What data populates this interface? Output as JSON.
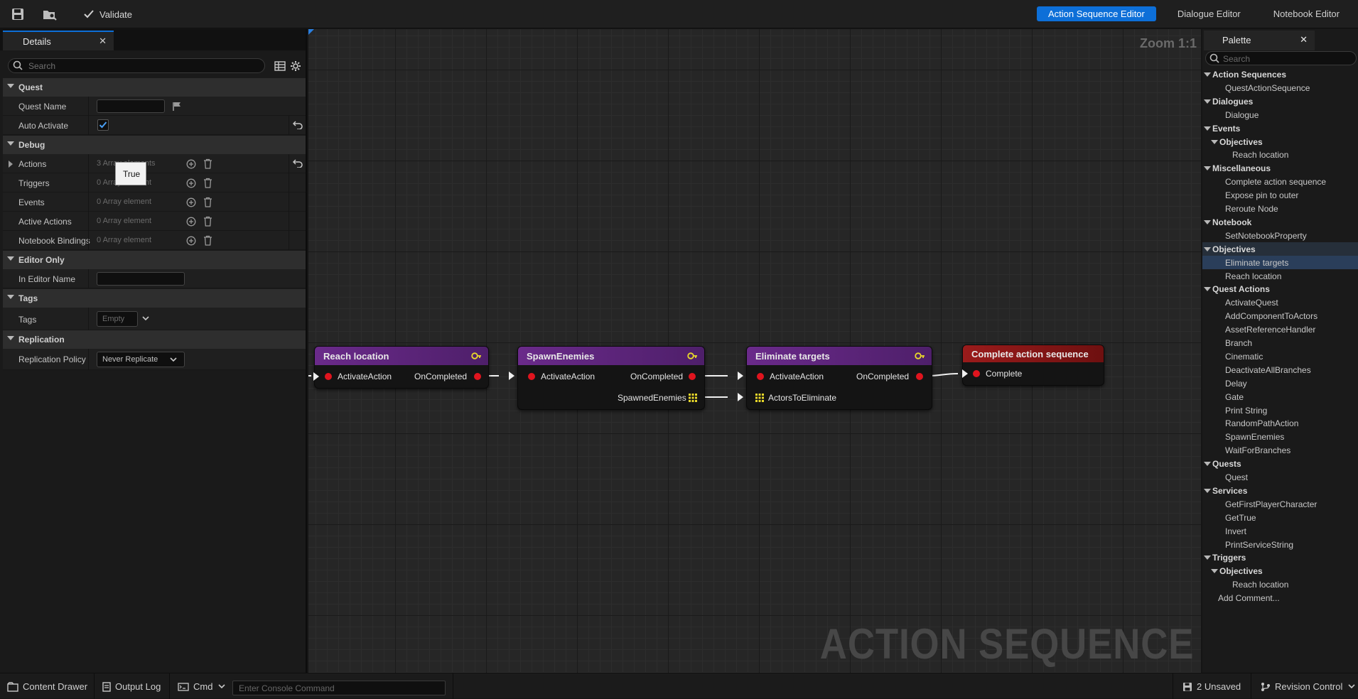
{
  "toolbar": {
    "validate_label": "Validate",
    "modes": [
      "Action Sequence Editor",
      "Dialogue Editor",
      "Notebook Editor"
    ]
  },
  "details": {
    "tab_title": "Details",
    "search_placeholder": "Search",
    "tooltip": "True",
    "sections": {
      "quest": "Quest",
      "debug": "Debug",
      "editor_only": "Editor Only",
      "tags": "Tags",
      "replication": "Replication"
    },
    "props": {
      "quest_name": "Quest Name",
      "auto_activate": "Auto Activate",
      "actions": "Actions",
      "actions_val": "3 Array elements",
      "triggers": "Triggers",
      "triggers_val": "0 Array element",
      "events": "Events",
      "events_val": "0 Array element",
      "active_actions": "Active Actions",
      "active_actions_val": "0 Array element",
      "notebook_bindings": "Notebook Bindings",
      "notebook_bindings_val": "0 Array element",
      "in_editor_name": "In Editor Name",
      "tags": "Tags",
      "tags_val": "Empty",
      "replication_policy": "Replication Policy",
      "replication_policy_val": "Never Replicate"
    }
  },
  "graph": {
    "zoom": "Zoom 1:1",
    "watermark": "ACTION SEQUENCE",
    "nodes": {
      "n1": {
        "title": "Reach location",
        "in": "ActivateAction",
        "out": "OnCompleted"
      },
      "n2": {
        "title": "SpawnEnemies",
        "in": "ActivateAction",
        "out": "OnCompleted",
        "out2": "SpawnedEnemies"
      },
      "n3": {
        "title": "Eliminate targets",
        "in": "ActivateAction",
        "out": "OnCompleted",
        "in2": "ActorsToEliminate"
      },
      "n4": {
        "title": "Complete action sequence",
        "in": "Complete"
      }
    }
  },
  "palette": {
    "tab_title": "Palette",
    "search_placeholder": "Search",
    "items": [
      {
        "label": "Action Sequences",
        "type": "cat",
        "depth": 0
      },
      {
        "label": "QuestActionSequence",
        "type": "item",
        "depth": 1
      },
      {
        "label": "Dialogues",
        "type": "cat",
        "depth": 0
      },
      {
        "label": "Dialogue",
        "type": "item",
        "depth": 1
      },
      {
        "label": "Events",
        "type": "cat",
        "depth": 0
      },
      {
        "label": "Objectives",
        "type": "cat",
        "depth": 1
      },
      {
        "label": "Reach location",
        "type": "item",
        "depth": 2
      },
      {
        "label": "Miscellaneous",
        "type": "cat",
        "depth": 0
      },
      {
        "label": "Complete action sequence",
        "type": "item",
        "depth": 1
      },
      {
        "label": "Expose pin to outer",
        "type": "item",
        "depth": 1
      },
      {
        "label": "Reroute Node",
        "type": "item",
        "depth": 1
      },
      {
        "label": "Notebook",
        "type": "cat",
        "depth": 0
      },
      {
        "label": "SetNotebookProperty",
        "type": "item",
        "depth": 1
      },
      {
        "label": "Objectives",
        "type": "cat",
        "depth": 0,
        "highlight": true
      },
      {
        "label": "Eliminate targets",
        "type": "item",
        "depth": 1,
        "selected": true
      },
      {
        "label": "Reach location",
        "type": "item",
        "depth": 1
      },
      {
        "label": "Quest Actions",
        "type": "cat",
        "depth": 0
      },
      {
        "label": "ActivateQuest",
        "type": "item",
        "depth": 1
      },
      {
        "label": "AddComponentToActors",
        "type": "item",
        "depth": 1
      },
      {
        "label": "AssetReferenceHandler",
        "type": "item",
        "depth": 1
      },
      {
        "label": "Branch",
        "type": "item",
        "depth": 1
      },
      {
        "label": "Cinematic",
        "type": "item",
        "depth": 1
      },
      {
        "label": "DeactivateAllBranches",
        "type": "item",
        "depth": 1
      },
      {
        "label": "Delay",
        "type": "item",
        "depth": 1
      },
      {
        "label": "Gate",
        "type": "item",
        "depth": 1
      },
      {
        "label": "Print String",
        "type": "item",
        "depth": 1
      },
      {
        "label": "RandomPathAction",
        "type": "item",
        "depth": 1
      },
      {
        "label": "SpawnEnemies",
        "type": "item",
        "depth": 1
      },
      {
        "label": "WaitForBranches",
        "type": "item",
        "depth": 1
      },
      {
        "label": "Quests",
        "type": "cat",
        "depth": 0
      },
      {
        "label": "Quest",
        "type": "item",
        "depth": 1
      },
      {
        "label": "Services",
        "type": "cat",
        "depth": 0
      },
      {
        "label": "GetFirstPlayerCharacter",
        "type": "item",
        "depth": 1
      },
      {
        "label": "GetTrue",
        "type": "item",
        "depth": 1
      },
      {
        "label": "Invert",
        "type": "item",
        "depth": 1
      },
      {
        "label": "PrintServiceString",
        "type": "item",
        "depth": 1
      },
      {
        "label": "Triggers",
        "type": "cat",
        "depth": 0
      },
      {
        "label": "Objectives",
        "type": "cat",
        "depth": 1
      },
      {
        "label": "Reach location",
        "type": "item",
        "depth": 2
      },
      {
        "label": "Add Comment...",
        "type": "plain",
        "depth": 0
      }
    ]
  },
  "statusbar": {
    "content_drawer": "Content Drawer",
    "output_log": "Output Log",
    "cmd": "Cmd",
    "console_placeholder": "Enter Console Command",
    "unsaved": "2 Unsaved",
    "revision_control": "Revision Control"
  }
}
